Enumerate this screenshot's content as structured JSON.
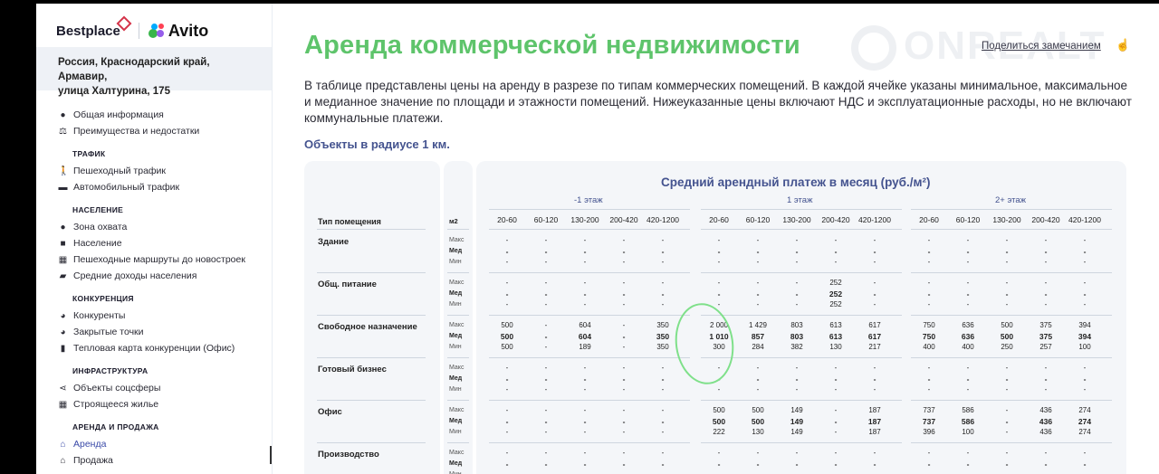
{
  "brand": {
    "bestplace": "Bestplace",
    "avito": "Avito"
  },
  "address": {
    "line1": "Россия, Краснодарский край, Армавир,",
    "line2": "улица Халтурина, 175"
  },
  "menu": {
    "general": [
      {
        "label": "Общая информация",
        "icon": "info-icon"
      },
      {
        "label": "Преимущества и недостатки",
        "icon": "scales-icon"
      }
    ],
    "sections": [
      {
        "title": "ТРАФИК",
        "items": [
          {
            "label": "Пешеходный трафик",
            "icon": "walker-icon"
          },
          {
            "label": "Автомобильный трафик",
            "icon": "car-icon"
          }
        ]
      },
      {
        "title": "НАСЕЛЕНИЕ",
        "items": [
          {
            "label": "Зона охвата",
            "icon": "people-icon"
          },
          {
            "label": "Население",
            "icon": "house-icon"
          },
          {
            "label": "Пешеходные маршруты до новостроек",
            "icon": "buildings-icon"
          },
          {
            "label": "Средние доходы населения",
            "icon": "wallet-icon"
          }
        ]
      },
      {
        "title": "КОНКУРЕНЦИЯ",
        "items": [
          {
            "label": "Конкуренты",
            "icon": "pie-icon"
          },
          {
            "label": "Закрытые точки",
            "icon": "pie-icon"
          },
          {
            "label": "Тепловая карта конкуренции (Офис)",
            "icon": "map-icon"
          }
        ]
      },
      {
        "title": "ИНФРАСТРУКТУРА",
        "items": [
          {
            "label": "Объекты соцсферы",
            "icon": "share-icon"
          },
          {
            "label": "Строящееся жилье",
            "icon": "building-icon"
          }
        ]
      },
      {
        "title": "АРЕНДА И ПРОДАЖА",
        "items": [
          {
            "label": "Аренда",
            "icon": "shop-icon",
            "active": true
          },
          {
            "label": "Продажа",
            "icon": "shop-icon"
          }
        ]
      }
    ]
  },
  "main": {
    "title": "Аренда коммерческой недвижимости",
    "share_label": "Поделиться замечанием",
    "watermark": "ONREALT",
    "description": "В таблице представлены цены на аренду в разрезе по типам коммерческих помещений. В каждой ячейке указаны минимальное, максимальное и медианное значение по площади и этажности помещений. Нижеуказанные цены включают НДС и эксплуатационные расходы, но не включают коммунальные платежи.",
    "radius_label": "Объекты в радиусе 1 км."
  },
  "table": {
    "title": "Средний арендный платеж в месяц (руб./м²)",
    "type_header": "Тип помещения",
    "m2_header": "м2",
    "floors": [
      "-1 этаж",
      "1 этаж",
      "2+ этаж"
    ],
    "ranges": [
      "20-60",
      "60-120",
      "130-200",
      "200-420",
      "420-1200"
    ],
    "stat_labels": [
      "Макс",
      "Мед",
      "Мин"
    ],
    "rows": [
      {
        "name": "Здание",
        "values": [
          [
            "-",
            "-",
            "-",
            "-",
            "-",
            "-",
            "-",
            "-",
            "-",
            "-",
            "-",
            "-",
            "-",
            "-",
            "-"
          ],
          [
            "-",
            "-",
            "-",
            "-",
            "-",
            "-",
            "-",
            "-",
            "-",
            "-",
            "-",
            "-",
            "-",
            "-",
            "-"
          ],
          [
            "-",
            "-",
            "-",
            "-",
            "-",
            "-",
            "-",
            "-",
            "-",
            "-",
            "-",
            "-",
            "-",
            "-",
            "-"
          ]
        ]
      },
      {
        "name": "Общ. питание",
        "values": [
          [
            "-",
            "-",
            "-",
            "-",
            "-",
            "-",
            "-",
            "-",
            "252",
            "-",
            "-",
            "-",
            "-",
            "-",
            "-"
          ],
          [
            "-",
            "-",
            "-",
            "-",
            "-",
            "-",
            "-",
            "-",
            "252",
            "-",
            "-",
            "-",
            "-",
            "-",
            "-"
          ],
          [
            "-",
            "-",
            "-",
            "-",
            "-",
            "-",
            "-",
            "-",
            "252",
            "-",
            "-",
            "-",
            "-",
            "-",
            "-"
          ]
        ]
      },
      {
        "name": "Свободное назначение",
        "values": [
          [
            "500",
            "-",
            "604",
            "-",
            "350",
            "2 000",
            "1 429",
            "803",
            "613",
            "617",
            "750",
            "636",
            "500",
            "375",
            "394"
          ],
          [
            "500",
            "-",
            "604",
            "-",
            "350",
            "1 010",
            "857",
            "803",
            "613",
            "617",
            "750",
            "636",
            "500",
            "375",
            "394"
          ],
          [
            "500",
            "-",
            "189",
            "-",
            "350",
            "300",
            "284",
            "382",
            "130",
            "217",
            "400",
            "400",
            "250",
            "257",
            "100"
          ]
        ]
      },
      {
        "name": "Готовый бизнес",
        "values": [
          [
            "-",
            "-",
            "-",
            "-",
            "-",
            "-",
            "-",
            "-",
            "-",
            "-",
            "-",
            "-",
            "-",
            "-",
            "-"
          ],
          [
            "-",
            "-",
            "-",
            "-",
            "-",
            "-",
            "-",
            "-",
            "-",
            "-",
            "-",
            "-",
            "-",
            "-",
            "-"
          ],
          [
            "-",
            "-",
            "-",
            "-",
            "-",
            "-",
            "-",
            "-",
            "-",
            "-",
            "-",
            "-",
            "-",
            "-",
            "-"
          ]
        ]
      },
      {
        "name": "Офис",
        "values": [
          [
            "-",
            "-",
            "-",
            "-",
            "-",
            "500",
            "500",
            "149",
            "-",
            "187",
            "737",
            "586",
            "-",
            "436",
            "274"
          ],
          [
            "-",
            "-",
            "-",
            "-",
            "-",
            "500",
            "500",
            "149",
            "-",
            "187",
            "737",
            "586",
            "-",
            "436",
            "274"
          ],
          [
            "-",
            "-",
            "-",
            "-",
            "-",
            "222",
            "130",
            "149",
            "-",
            "187",
            "396",
            "100",
            "-",
            "436",
            "274"
          ]
        ]
      },
      {
        "name": "Производство",
        "values": [
          [
            "-",
            "-",
            "-",
            "-",
            "-",
            "-",
            "-",
            "-",
            "-",
            "-",
            "-",
            "-",
            "-",
            "-",
            "-"
          ],
          [
            "-",
            "-",
            "-",
            "-",
            "-",
            "-",
            "-",
            "-",
            "-",
            "-",
            "-",
            "-",
            "-",
            "-",
            "-"
          ],
          [
            "-",
            "-",
            "-",
            "-",
            "-",
            "-",
            "-",
            "-",
            "-",
            "-",
            "-",
            "-",
            "-",
            "-",
            "-"
          ]
        ]
      }
    ]
  },
  "colors": {
    "title_green": "#5ec46b",
    "accent_blue": "#44538f",
    "annotation_green": "#7fe08a"
  }
}
